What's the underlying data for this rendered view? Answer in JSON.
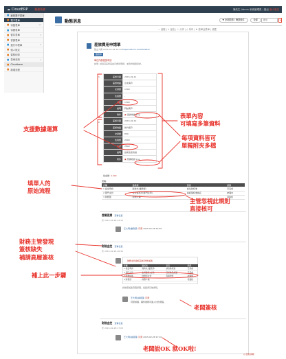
{
  "topbar": {
    "brand": "☁ CloudERP",
    "brand_sub": "業務系統",
    "user": "陳先生",
    "user_meta": "Admin 系統管理員 | 登出",
    "user_link": "個人設定"
  },
  "sidebar": {
    "items": [
      {
        "label": "我的電子表單",
        "icon": "form-icon",
        "cnt": "",
        "type": "head"
      },
      {
        "label": "電子表單",
        "icon": "list-icon",
        "cnt": "",
        "type": "active"
      },
      {
        "label": "待簽表單",
        "icon": "pen-icon",
        "cnt": "12",
        "type": ""
      },
      {
        "label": "待閱表單",
        "icon": "eye-icon",
        "cnt": "",
        "type": ""
      },
      {
        "label": "暫存表單",
        "icon": "save-icon",
        "cnt": "3",
        "type": ""
      },
      {
        "label": "會辦表單",
        "icon": "people-icon",
        "cnt": "",
        "type": ""
      },
      {
        "label": "進行中表單",
        "icon": "clock-icon",
        "cnt": "5",
        "type": ""
      },
      {
        "label": "個人設定",
        "icon": "gear-icon",
        "cnt": "",
        "type": ""
      },
      {
        "label": "簽核紀錄",
        "icon": "history-icon",
        "cnt": "",
        "type": ""
      },
      {
        "label": "表單查詢",
        "icon": "search-icon",
        "cnt": "1",
        "type": ""
      },
      {
        "label": "Cloudbase",
        "icon": "cloud-icon",
        "cnt": "",
        "type": "head"
      },
      {
        "label": "新增流程",
        "icon": "plus-icon",
        "cnt": "",
        "type": ""
      }
    ]
  },
  "header": {
    "title": "動態消息",
    "btn_filter": "▼ 全部動態 / 篩選條件",
    "btn_all": "全部",
    "search_placeholder": "搜尋",
    "close": "×"
  },
  "toolbar_links": "☆ 追蹤  |  ✎ 留言  |  ⇪ 分享  |  ⎙ 列印  |  ⚑ 檢舉此表單  |  收藏",
  "doc": {
    "title": "差旅費用申請單",
    "meta_prefix": "建立人員 2015-02-28 10:32  ",
    "meta_link": "ExpenseForm-20150228-8",
    "tag": "簽核中",
    "subtitle": "單位內部差旅申請",
    "desc": "說明: 請填寫差旅事由及費用明細，並檢附相關單據。"
  },
  "form": {
    "rows": [
      {
        "label": "差旅日期",
        "value": "2015-02-11"
      },
      {
        "label": "差旅地點",
        "value": "台北客戶"
      },
      {
        "label": "交通費",
        "value": "1500"
      },
      {
        "label": "住宿費",
        "value": "-"
      },
      {
        "label": "小計",
        "value": "1500"
      },
      {
        "label": "說明",
        "value": "拜訪客戶"
      },
      {
        "label": "附件",
        "value": "單據收據.png"
      },
      {
        "label": "差旅日期",
        "value": "2015-02-12"
      },
      {
        "label": "差旅地點",
        "value": "新竹客戶"
      },
      {
        "label": "交通費",
        "value": "800"
      },
      {
        "label": "住宿費",
        "value": "2000"
      },
      {
        "label": "小計",
        "value": "2800"
      },
      {
        "label": "說明",
        "value": "技術支援會議"
      },
      {
        "label": "附件",
        "value": "發票收據.png"
      }
    ],
    "total_label": "總金額:",
    "total_value": "4,300"
  },
  "process": {
    "label": "流程:",
    "headers": [
      "步驟",
      "簽核者",
      "意見",
      "狀態"
    ],
    "rows": [
      [
        "1 提出申請",
        "陳秀文(業務部)",
        "請協助核准",
        "已完成"
      ],
      [
        "2 部門主管",
        "主管審核中(部門主管)",
        "總經理核准簽名",
        "處理中"
      ],
      [
        "3 財務部",
        "財務人員",
        "",
        "待簽核"
      ]
    ]
  },
  "comments": {
    "c1_author": "首爾直播",
    "c1_link": "查看表單",
    "c1_time": "於 2015-02-28 14:10",
    "c1_reply_name": "王大明(業務部)",
    "c1_reply_link": "同意",
    "c1_reply_text": "2015-02-28 14:50",
    "c2_author": "財務金控",
    "c2_link": "查看表單",
    "c2_time": "於 2015-02-28 16:30",
    "inner_title": "財務主管審核完成 附件加簽",
    "inner_headers": [
      "步驟",
      "簽核者",
      "意見",
      "狀態"
    ],
    "inner_rows": [
      [
        "1 提出申請",
        "陳秀文(業務部)",
        "請協助核准",
        "已完成"
      ],
      [
        "2 部門主管",
        "主管簽核(主管)",
        "已核准及加簽",
        "已完成"
      ],
      [
        "3 財務加簽",
        "財務部主管",
        "需補附件",
        "處理中"
      ],
      [
        "4 財務部",
        "財務人員",
        "",
        "待簽核"
      ]
    ],
    "inner_note": "請依照加簽流程辦理，加簽者已被通知。",
    "c2_reply_name": "王大明(總經理)",
    "c2_reply_link": "同意",
    "c2_reply_text": "同意辦理，補件後即可進入付款流程。",
    "c3_author": "財務金控",
    "c3_link": "查看表單",
    "c3_time": "於 2015-02-28 17:05",
    "c3_reply_name": "王大明(總經理)",
    "c3_reply_link": "同意",
    "c3_reply_text": "2015-02-28 17:10"
  },
  "bottom_button": "◎ 回到頂端",
  "annotations": {
    "a1": [
      "表單內容",
      "可填寫多筆資料"
    ],
    "a2": "支援數據運算",
    "a3": [
      "每項資料皆可",
      "單獨附夾多檔"
    ],
    "a4": [
      "填單人的",
      "原始流程"
    ],
    "a5": [
      "主管忽視此規則",
      "直接核可"
    ],
    "a6": [
      "財務主管發現",
      "簽核缺失",
      "補請高層簽核"
    ],
    "a7": "補上此一步驟",
    "a8": "老闆簽核",
    "a9": "老闆說OK 就OK啦!"
  },
  "colors": {
    "accent": "#2f4050",
    "link": "#3a6ea5",
    "annotation": "#e8312a"
  }
}
